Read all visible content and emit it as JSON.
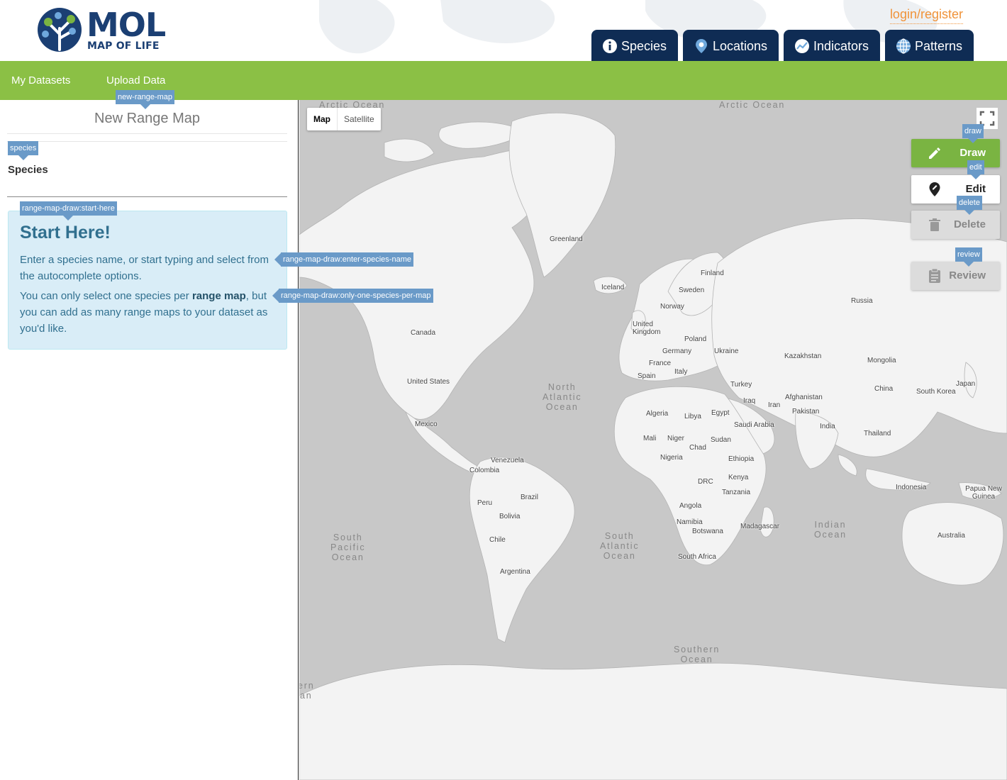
{
  "header": {
    "logo_title": "MOL",
    "logo_subtitle": "MAP OF LIFE",
    "login_label": "login/register",
    "tabs": [
      {
        "label": "Species",
        "icon": "info-circle-icon"
      },
      {
        "label": "Locations",
        "icon": "map-pin-icon"
      },
      {
        "label": "Indicators",
        "icon": "trend-chart-icon"
      },
      {
        "label": "Patterns",
        "icon": "globe-grid-icon"
      }
    ]
  },
  "subnav": {
    "my_datasets": "My Datasets",
    "upload_data": "Upload Data"
  },
  "panel": {
    "title": "New Range Map",
    "species_label": "Species",
    "species_value": "",
    "start_title": "Start Here!",
    "start_p1": "Enter a species name, or start typing and select from the autocomplete options.",
    "start_p2_a": "You can only select one species per ",
    "start_p2_b": "range map",
    "start_p2_c": ", but you can add as many range maps to your dataset as you'd like."
  },
  "tooltips": {
    "new_range_map": "new-range-map",
    "species": "species",
    "start_here": "range-map-draw:start-here",
    "enter_species": "range-map-draw:enter-species-name",
    "one_species": "range-map-draw:only-one-species-per-map",
    "draw": "draw",
    "edit": "edit",
    "delete": "delete",
    "review": "review"
  },
  "map": {
    "type_map": "Map",
    "type_satellite": "Satellite",
    "tools": {
      "draw": "Draw",
      "edit": "Edit",
      "delete": "Delete",
      "review": "Review"
    },
    "oceans": {
      "arctic_left": "Arctic Ocean",
      "arctic_right": "Arctic Ocean",
      "north_atlantic": [
        "North",
        "Atlantic",
        "Ocean"
      ],
      "south_pacific": [
        "South",
        "Pacific",
        "Ocean"
      ],
      "south_atlantic": [
        "South",
        "Atlantic",
        "Ocean"
      ],
      "indian": [
        "Indian",
        "Ocean"
      ],
      "southern": [
        "Southern",
        "Ocean"
      ],
      "partial_left": [
        "ern",
        "an"
      ]
    },
    "countries": {
      "greenland": "Greenland",
      "iceland": "Iceland",
      "finland": "Finland",
      "sweden": "Sweden",
      "norway": "Norway",
      "russia": "Russia",
      "uk": "United Kingdom",
      "poland": "Poland",
      "germany": "Germany",
      "ukraine": "Ukraine",
      "kazakhstan": "Kazakhstan",
      "mongolia": "Mongolia",
      "france": "France",
      "italy": "Italy",
      "spain": "Spain",
      "turkey": "Turkey",
      "china": "China",
      "south_korea": "South Korea",
      "japan": "Japan",
      "canada": "Canada",
      "usa": "United States",
      "mexico": "Mexico",
      "iraq": "Iraq",
      "iran": "Iran",
      "afghanistan": "Afghanistan",
      "pakistan": "Pakistan",
      "algeria": "Algeria",
      "libya": "Libya",
      "egypt": "Egypt",
      "saudi": "Saudi Arabia",
      "india": "India",
      "thailand": "Thailand",
      "mali": "Mali",
      "niger": "Niger",
      "chad": "Chad",
      "sudan": "Sudan",
      "nigeria": "Nigeria",
      "ethiopia": "Ethiopia",
      "venezuela": "Venezuela",
      "colombia": "Colombia",
      "kenya": "Kenya",
      "drc": "DRC",
      "tanzania": "Tanzania",
      "indonesia": "Indonesia",
      "png": "Papua New Guinea",
      "brazil": "Brazil",
      "peru": "Peru",
      "bolivia": "Bolivia",
      "angola": "Angola",
      "namibia": "Namibia",
      "botswana": "Botswana",
      "madagascar": "Madagascar",
      "chile": "Chile",
      "south_africa": "South Africa",
      "australia": "Australia",
      "argentina": "Argentina"
    }
  },
  "colors": {
    "brand_navy": "#0f2c54",
    "subbar_green": "#8bc045",
    "login_orange": "#f0933a",
    "draw_green": "#7ab442",
    "tooltip_blue": "#6a9ac8",
    "land": "#f3f3f3",
    "water": "#c8c8c8"
  }
}
